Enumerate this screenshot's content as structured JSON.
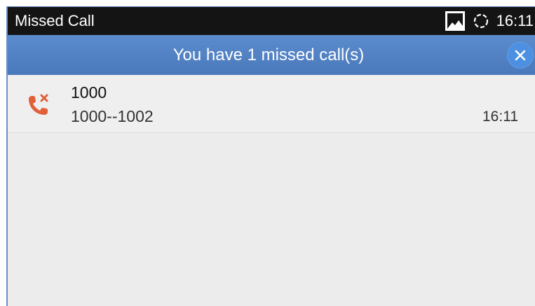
{
  "status_bar": {
    "title": "Missed Call",
    "time": "16:11",
    "icons": [
      "image-icon",
      "sync-icon"
    ]
  },
  "notification": {
    "message": "You have 1 missed call(s)",
    "close_icon": "close-icon",
    "accent": "#4d8fe0"
  },
  "calls": [
    {
      "name": "1000",
      "detail": "1000--1002",
      "time": "16:11",
      "icon": "missed-call-icon",
      "icon_color": "#e0603a"
    }
  ]
}
